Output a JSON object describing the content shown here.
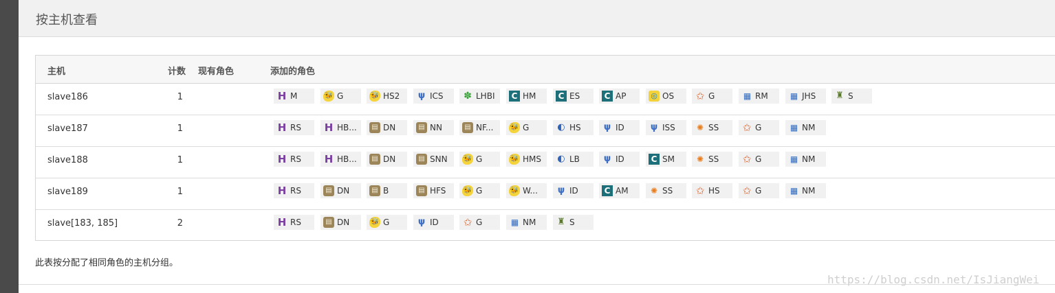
{
  "header": {
    "title": "按主机查看"
  },
  "table": {
    "columns": {
      "host": "主机",
      "count": "计数",
      "existing": "现有角色",
      "added": "添加的角色"
    },
    "rows": [
      {
        "host": "slave186",
        "count": "1",
        "roles": [
          {
            "icon": "hbase-icon",
            "glyph": "H",
            "label": "M"
          },
          {
            "icon": "hive-icon",
            "glyph": "🐝",
            "label": "G"
          },
          {
            "icon": "hive-icon",
            "glyph": "🐝",
            "label": "HS2"
          },
          {
            "icon": "hue-icon",
            "glyph": "ψ",
            "label": "ICS"
          },
          {
            "icon": "lily-icon",
            "glyph": "✽",
            "label": "LHBI"
          },
          {
            "icon": "cloudera-icon",
            "glyph": "C",
            "label": "HM"
          },
          {
            "icon": "cloudera-icon",
            "glyph": "C",
            "label": "ES"
          },
          {
            "icon": "cloudera-icon",
            "glyph": "C",
            "label": "AP"
          },
          {
            "icon": "oozie-icon",
            "glyph": "◎",
            "label": "OS"
          },
          {
            "icon": "star-icon",
            "glyph": "✩",
            "label": "G"
          },
          {
            "icon": "yarn-icon",
            "glyph": "▦",
            "label": "RM"
          },
          {
            "icon": "yarn-icon",
            "glyph": "▦",
            "label": "JHS"
          },
          {
            "icon": "sqoop-icon",
            "glyph": "♜",
            "label": "S"
          }
        ]
      },
      {
        "host": "slave187",
        "count": "1",
        "roles": [
          {
            "icon": "hbase-icon",
            "glyph": "H",
            "label": "RS"
          },
          {
            "icon": "hbase-icon",
            "glyph": "H",
            "label": "HB..."
          },
          {
            "icon": "hdfs-icon",
            "glyph": "▤",
            "label": "DN"
          },
          {
            "icon": "hdfs-icon",
            "glyph": "▤",
            "label": "NN"
          },
          {
            "icon": "hdfs-icon",
            "glyph": "▤",
            "label": "NF..."
          },
          {
            "icon": "hive-icon",
            "glyph": "🐝",
            "label": "G"
          },
          {
            "icon": "hbase-lb-icon",
            "glyph": "◐",
            "label": "HS"
          },
          {
            "icon": "hue-icon",
            "glyph": "ψ",
            "label": "ID"
          },
          {
            "icon": "hue-icon",
            "glyph": "ψ",
            "label": "ISS"
          },
          {
            "icon": "spark-icon",
            "glyph": "✺",
            "label": "SS"
          },
          {
            "icon": "star-icon",
            "glyph": "✩",
            "label": "G"
          },
          {
            "icon": "yarn-icon",
            "glyph": "▦",
            "label": "NM"
          }
        ]
      },
      {
        "host": "slave188",
        "count": "1",
        "roles": [
          {
            "icon": "hbase-icon",
            "glyph": "H",
            "label": "RS"
          },
          {
            "icon": "hbase-icon",
            "glyph": "H",
            "label": "HB..."
          },
          {
            "icon": "hdfs-icon",
            "glyph": "▤",
            "label": "DN"
          },
          {
            "icon": "hdfs-icon",
            "glyph": "▤",
            "label": "SNN"
          },
          {
            "icon": "hive-icon",
            "glyph": "🐝",
            "label": "G"
          },
          {
            "icon": "hive-icon",
            "glyph": "🐝",
            "label": "HMS"
          },
          {
            "icon": "hbase-lb-icon",
            "glyph": "◐",
            "label": "LB"
          },
          {
            "icon": "hue-icon",
            "glyph": "ψ",
            "label": "ID"
          },
          {
            "icon": "cloudera-icon",
            "glyph": "C",
            "label": "SM"
          },
          {
            "icon": "spark-icon",
            "glyph": "✺",
            "label": "SS"
          },
          {
            "icon": "star-icon",
            "glyph": "✩",
            "label": "G"
          },
          {
            "icon": "yarn-icon",
            "glyph": "▦",
            "label": "NM"
          }
        ]
      },
      {
        "host": "slave189",
        "count": "1",
        "roles": [
          {
            "icon": "hbase-icon",
            "glyph": "H",
            "label": "RS"
          },
          {
            "icon": "hdfs-icon",
            "glyph": "▤",
            "label": "DN"
          },
          {
            "icon": "hdfs-icon",
            "glyph": "▤",
            "label": "B"
          },
          {
            "icon": "hdfs-icon",
            "glyph": "▤",
            "label": "HFS"
          },
          {
            "icon": "hive-icon",
            "glyph": "🐝",
            "label": "G"
          },
          {
            "icon": "hive-icon",
            "glyph": "🐝",
            "label": "W..."
          },
          {
            "icon": "hue-icon",
            "glyph": "ψ",
            "label": "ID"
          },
          {
            "icon": "cloudera-icon",
            "glyph": "C",
            "label": "AM"
          },
          {
            "icon": "spark-icon",
            "glyph": "✺",
            "label": "SS"
          },
          {
            "icon": "star-icon",
            "glyph": "✩",
            "label": "HS"
          },
          {
            "icon": "star-icon",
            "glyph": "✩",
            "label": "G"
          },
          {
            "icon": "yarn-icon",
            "glyph": "▦",
            "label": "NM"
          }
        ]
      },
      {
        "host": "slave[183, 185]",
        "count": "2",
        "roles": [
          {
            "icon": "hbase-icon",
            "glyph": "H",
            "label": "RS"
          },
          {
            "icon": "hdfs-icon",
            "glyph": "▤",
            "label": "DN"
          },
          {
            "icon": "hive-icon",
            "glyph": "🐝",
            "label": "G"
          },
          {
            "icon": "hue-icon",
            "glyph": "ψ",
            "label": "ID"
          },
          {
            "icon": "star-icon",
            "glyph": "✩",
            "label": "G"
          },
          {
            "icon": "yarn-icon",
            "glyph": "▦",
            "label": "NM"
          },
          {
            "icon": "sqoop-icon",
            "glyph": "♜",
            "label": "S"
          }
        ]
      }
    ]
  },
  "footnote": "此表按分配了相同角色的主机分组。",
  "watermark": "https://blog.csdn.net/IsJiangWei"
}
